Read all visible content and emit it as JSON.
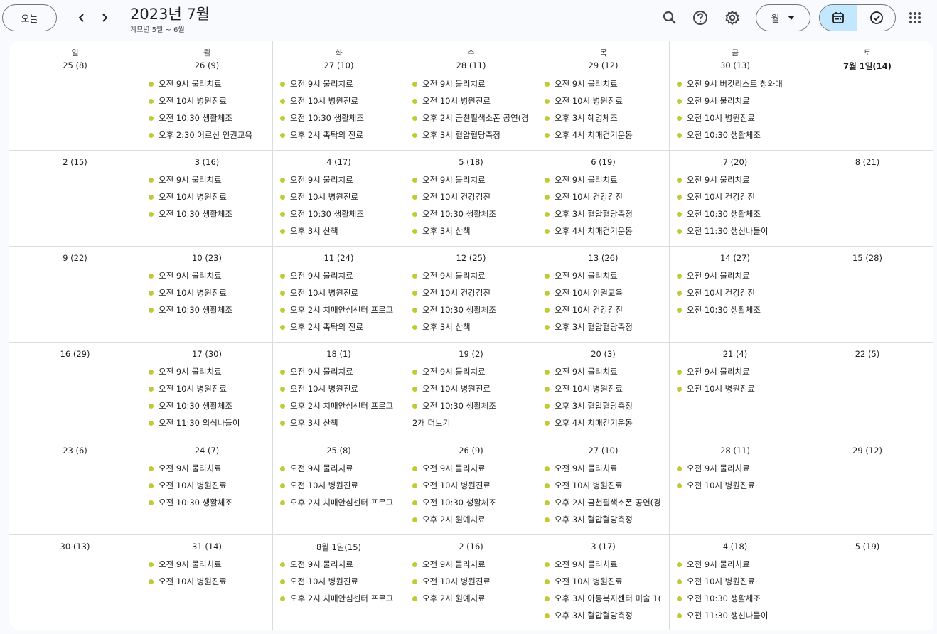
{
  "header": {
    "today_label": "오늘",
    "title": "2023년 7월",
    "subtitle": "계묘년 5월 ~ 6월",
    "view_label": "월",
    "icons": [
      "search-icon",
      "help-icon",
      "settings-icon",
      "calendar-icon",
      "tasks-icon",
      "apps-icon"
    ]
  },
  "colors": {
    "event_dot": "#c0ca33",
    "active_toggle": "#c2e7ff",
    "border": "#dadce0"
  },
  "weekdays": [
    "일",
    "월",
    "화",
    "수",
    "목",
    "금",
    "토"
  ],
  "weeks": [
    [
      {
        "date": "25 (8)",
        "events": []
      },
      {
        "date": "26 (9)",
        "events": [
          "오전 9시 물리치료",
          "오전 10시 병원진료",
          "오전 10:30 생활체조",
          "오후 2:30 어르신 인권교육"
        ]
      },
      {
        "date": "27 (10)",
        "events": [
          "오전 9시 물리치료",
          "오전 10시 병원진료",
          "오전 10:30 생활체조",
          "오후 2시 촉탁의 진료"
        ]
      },
      {
        "date": "28 (11)",
        "events": [
          "오전 9시 물리치료",
          "오전 10시 병원진료",
          "오후 2시 금천필색소폰 공연(경",
          "오후 3시 혈압혈당측정"
        ]
      },
      {
        "date": "29 (12)",
        "events": [
          "오전 9시 물리치료",
          "오전 10시 병원진료",
          "오후 3시 혜명체조",
          "오후 4시 치매걷기운동"
        ]
      },
      {
        "date": "30 (13)",
        "events": [
          "오전 9시 버킷리스트 청와대",
          "오전 9시 물리치료",
          "오전 10시 병원진료",
          "오전 10:30 생활체조"
        ]
      },
      {
        "date": "7월 1일(14)",
        "bold": true,
        "events": []
      }
    ],
    [
      {
        "date": "2 (15)",
        "events": []
      },
      {
        "date": "3 (16)",
        "events": [
          "오전 9시 물리치료",
          "오전 10시 병원진료",
          "오전 10:30 생활체조"
        ]
      },
      {
        "date": "4 (17)",
        "events": [
          "오전 9시 물리치료",
          "오전 10시 병원진료",
          "오전 10:30 생활체조",
          "오후 3시 산책"
        ]
      },
      {
        "date": "5 (18)",
        "events": [
          "오전 9시 물리치료",
          "오전 10시 건강검진",
          "오전 10:30 생활체조",
          "오후 3시 산책"
        ]
      },
      {
        "date": "6 (19)",
        "events": [
          "오전 9시 물리치료",
          "오전 10시 건강검진",
          "오후 3시 혈압혈당측정",
          "오후 4시 치매걷기운동"
        ]
      },
      {
        "date": "7 (20)",
        "events": [
          "오전 9시 물리치료",
          "오전 10시 건강검진",
          "오전 10:30 생활체조",
          "오전 11:30 생신나들이"
        ]
      },
      {
        "date": "8 (21)",
        "events": []
      }
    ],
    [
      {
        "date": "9 (22)",
        "events": []
      },
      {
        "date": "10 (23)",
        "events": [
          "오전 9시 물리치료",
          "오전 10시 병원진료",
          "오전 10:30 생활체조"
        ]
      },
      {
        "date": "11 (24)",
        "events": [
          "오전 9시 물리치료",
          "오전 10시 병원진료",
          "오후 2시 치매안심센터 프로그",
          "오후 2시 촉탁의 진료"
        ]
      },
      {
        "date": "12 (25)",
        "events": [
          "오전 9시 물리치료",
          "오전 10시 건강검진",
          "오전 10:30 생활체조",
          "오후 3시 산책"
        ]
      },
      {
        "date": "13 (26)",
        "events": [
          "오전 9시 물리치료",
          "오전 10시 인권교육",
          "오전 10시 건강검진",
          "오후 3시 혈압혈당측정"
        ]
      },
      {
        "date": "14 (27)",
        "events": [
          "오전 9시 물리치료",
          "오전 10시 건강검진",
          "오전 10:30 생활체조"
        ]
      },
      {
        "date": "15 (28)",
        "events": []
      }
    ],
    [
      {
        "date": "16 (29)",
        "events": []
      },
      {
        "date": "17 (30)",
        "events": [
          "오전 9시 물리치료",
          "오전 10시 병원진료",
          "오전 10:30 생활체조",
          "오전 11:30 외식나들이"
        ]
      },
      {
        "date": "18 (1)",
        "events": [
          "오전 9시 물리치료",
          "오전 10시 병원진료",
          "오후 2시 치매안심센터 프로그",
          "오후 3시 산책"
        ]
      },
      {
        "date": "19 (2)",
        "events": [
          "오전 9시 물리치료",
          "오전 10시 병원진료",
          "오전 10:30 생활체조"
        ],
        "more": "2개 더보기"
      },
      {
        "date": "20 (3)",
        "events": [
          "오전 9시 물리치료",
          "오전 10시 병원진료",
          "오후 3시 혈압혈당측정",
          "오후 4시 치매걷기운동"
        ]
      },
      {
        "date": "21 (4)",
        "events": [
          "오전 9시 물리치료",
          "오전 10시 병원진료"
        ]
      },
      {
        "date": "22 (5)",
        "events": []
      }
    ],
    [
      {
        "date": "23 (6)",
        "events": []
      },
      {
        "date": "24 (7)",
        "events": [
          "오전 9시 물리치료",
          "오전 10시 병원진료",
          "오전 10:30 생활체조"
        ]
      },
      {
        "date": "25 (8)",
        "events": [
          "오전 9시 물리치료",
          "오전 10시 병원진료",
          "오후 2시 치매안심센터 프로그"
        ]
      },
      {
        "date": "26 (9)",
        "events": [
          "오전 9시 물리치료",
          "오전 10시 병원진료",
          "오전 10:30 생활체조",
          "오후 2시 원예치료"
        ]
      },
      {
        "date": "27 (10)",
        "events": [
          "오전 9시 물리치료",
          "오전 10시 병원진료",
          "오후 2시 금천필색소폰 공연(경",
          "오후 3시 혈압혈당측정"
        ]
      },
      {
        "date": "28 (11)",
        "events": [
          "오전 9시 물리치료",
          "오전 10시 병원진료"
        ]
      },
      {
        "date": "29 (12)",
        "events": []
      }
    ],
    [
      {
        "date": "30 (13)",
        "events": []
      },
      {
        "date": "31 (14)",
        "events": [
          "오전 9시 물리치료",
          "오전 10시 병원진료"
        ]
      },
      {
        "date": "8월 1일(15)",
        "events": [
          "오전 9시 물리치료",
          "오전 10시 병원진료",
          "오후 2시 치매안심센터 프로그"
        ]
      },
      {
        "date": "2 (16)",
        "events": [
          "오전 9시 물리치료",
          "오전 10시 병원진료",
          "오후 2시 원예치료"
        ]
      },
      {
        "date": "3 (17)",
        "events": [
          "오전 9시 물리치료",
          "오전 10시 병원진료",
          "오후 3시 아동복지센터 미술 1(",
          "오후 3시 혈압혈당측정"
        ]
      },
      {
        "date": "4 (18)",
        "events": [
          "오전 9시 물리치료",
          "오전 10시 병원진료",
          "오전 10:30 생활체조",
          "오전 11:30 생신나들이"
        ]
      },
      {
        "date": "5 (19)",
        "events": []
      }
    ]
  ]
}
